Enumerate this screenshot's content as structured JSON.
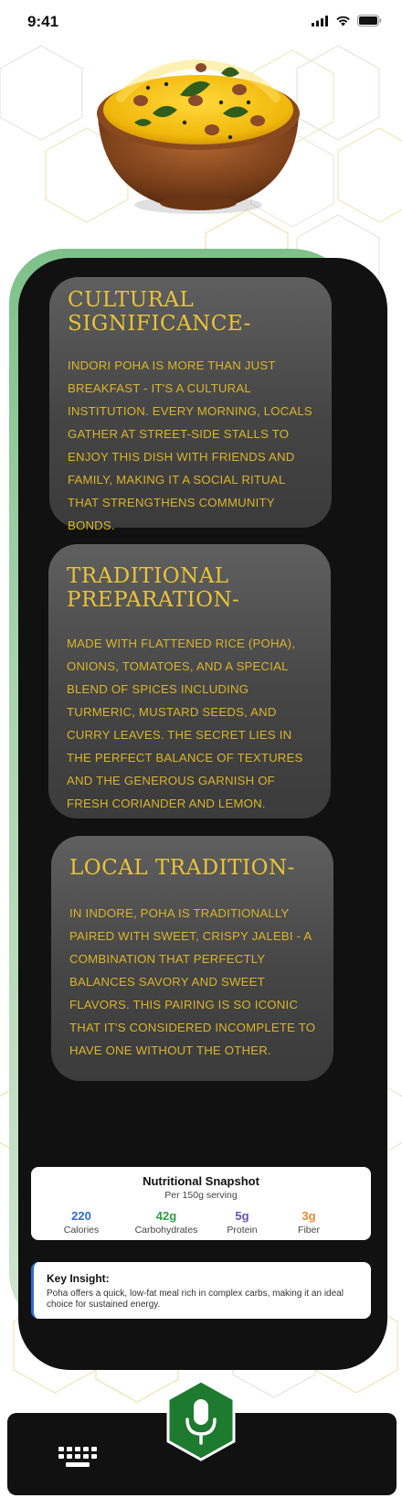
{
  "status_bar": {
    "time": "9:41",
    "icons": [
      "signal-icon",
      "wifi-icon",
      "battery-icon"
    ]
  },
  "hero": {
    "image": "poha-bowl-image"
  },
  "cards": [
    {
      "title": "Cultural Significance-",
      "body": "Indori Poha is more than just breakfast - it's a cultural institution. Every morning, locals gather at street-side stalls to enjoy this dish with friends and family, making it a social ritual that strengthens community bonds."
    },
    {
      "title": "Traditional Preparation-",
      "body": "Made with flattened rice (poha), onions, tomatoes, and a special blend of spices including turmeric, mustard seeds, and curry leaves. The secret lies in the perfect balance of textures and the generous garnish of fresh coriander and lemon."
    },
    {
      "title": "Local Tradition-",
      "body": "In Indore, poha is traditionally paired with sweet, crispy jalebi - a combination that perfectly balances savory and sweet flavors. This pairing is so iconic that it's considered incomplete to have one without the other."
    }
  ],
  "nutrition": {
    "title": "Nutritional Snapshot",
    "subtitle": "Per 150g serving",
    "items": [
      {
        "value": "220",
        "label": "Calories",
        "color": "#2b6cd6"
      },
      {
        "value": "42g",
        "label": "Carbohydrates",
        "color": "#2e9d47"
      },
      {
        "value": "5g",
        "label": "Protein",
        "color": "#6a4fb0"
      },
      {
        "value": "3g",
        "label": "Fiber",
        "color": "#e98a2e"
      }
    ]
  },
  "insight": {
    "title": "Key Insight:",
    "body": "Poha offers a quick, low-fat meal rich in complex carbs, making it an ideal choice for sustained energy."
  },
  "bottom_bar": {
    "keyboard_icon": "keyboard-icon",
    "mic_icon": "microphone-icon",
    "mic_color": "#1e7a2e"
  }
}
